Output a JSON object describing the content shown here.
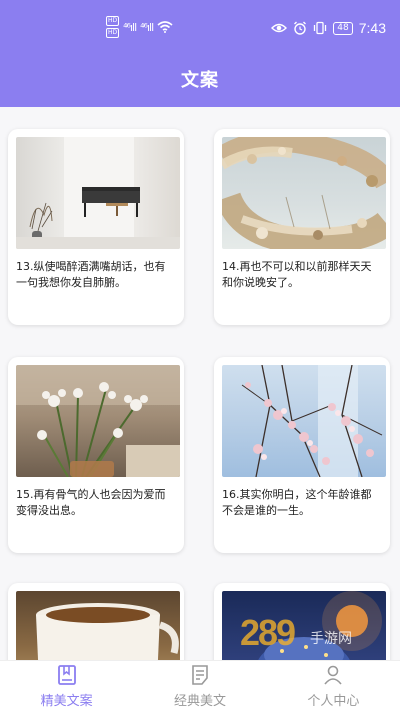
{
  "status_bar": {
    "hd1": "HD",
    "hd2": "HD",
    "sig1": "⁴⁶ıll",
    "sig2": "⁴⁶ıll",
    "battery": "48",
    "time": "7:43"
  },
  "header": {
    "title": "文案"
  },
  "cards": [
    {
      "text": "13.纵使喝醉酒满嘴胡话，也有一句我想你发自肺腑。"
    },
    {
      "text": "14.再也不可以和以前那样天天和你说晚安了。"
    },
    {
      "text": "15.再有骨气的人也会因为爱而变得没出息。"
    },
    {
      "text": "16.其实你明白，这个年龄谁都不会是谁的一生。"
    },
    {
      "text": ""
    },
    {
      "text": ""
    }
  ],
  "bottom_nav": [
    {
      "label": "精美文案",
      "icon": "book-icon",
      "active": true
    },
    {
      "label": "经典美文",
      "icon": "document-icon",
      "active": false
    },
    {
      "label": "个人中心",
      "icon": "person-icon",
      "active": false
    }
  ],
  "watermark": {
    "logo": "289",
    "text": "手游网"
  },
  "colors": {
    "accent": "#8b7ef0",
    "inactive": "#999999"
  }
}
